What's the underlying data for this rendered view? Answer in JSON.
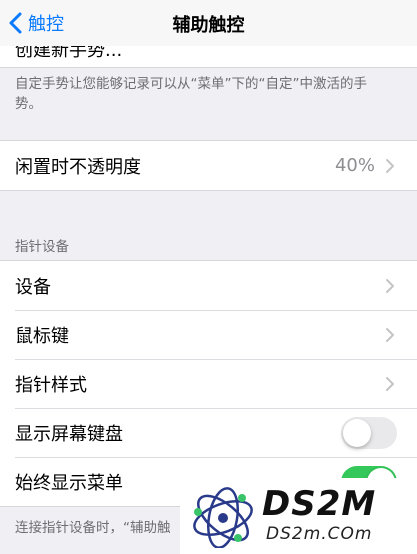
{
  "nav": {
    "back_label": "触控",
    "title": "辅助触控"
  },
  "partial_row": {
    "label": "创建新手势..."
  },
  "custom_gesture_note": "自定手势让您能够记录可以从“菜单”下的“自定”中激活的手势。",
  "idle_opacity": {
    "label": "闲置时不透明度",
    "value": "40%"
  },
  "pointer_section": {
    "header": "指针设备",
    "items": [
      {
        "label": "设备"
      },
      {
        "label": "鼠标键"
      },
      {
        "label": "指针样式"
      },
      {
        "label": "显示屏幕键盘",
        "toggle": false
      },
      {
        "label": "始终显示菜单",
        "toggle": true
      }
    ]
  },
  "footer_note": "连接指针设备时，“辅助触",
  "watermark": {
    "brand": "DS2M",
    "url": "DS2m.COm"
  },
  "colors": {
    "accent": "#0a7aff",
    "toggle_on": "#34c759",
    "toggle_off": "#e9e9eb",
    "background": "#efeff4"
  }
}
